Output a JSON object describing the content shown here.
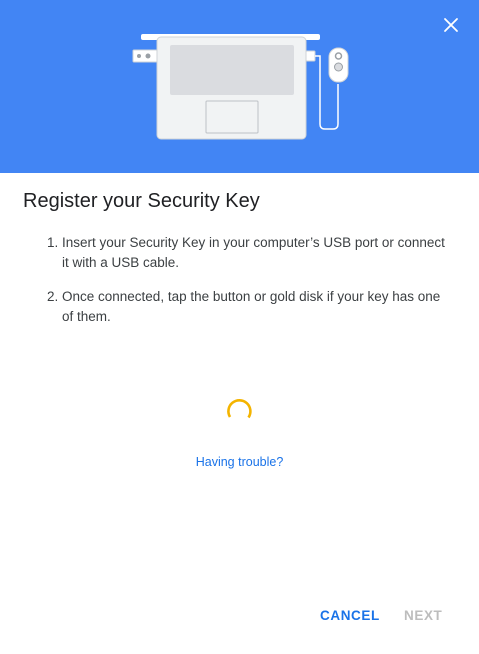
{
  "dialog": {
    "title": "Register your Security Key",
    "steps": [
      {
        "number": "1.",
        "text": "Insert your Security Key in your computer’s USB port or connect it with a USB cable."
      },
      {
        "number": "2.",
        "text": "Once connected, tap the button or gold disk if your key has one of them."
      }
    ],
    "trouble_link": "Having trouble?",
    "buttons": {
      "cancel": "CANCEL",
      "next": "NEXT"
    },
    "icons": {
      "close": "close-icon",
      "spinner": "loading-spinner-icon",
      "illustration": "laptop-security-key-illustration"
    },
    "colors": {
      "header_bg": "#4285f4",
      "accent": "#1a73e8",
      "spinner": "#f4b400",
      "disabled": "#bdbdbd"
    }
  }
}
